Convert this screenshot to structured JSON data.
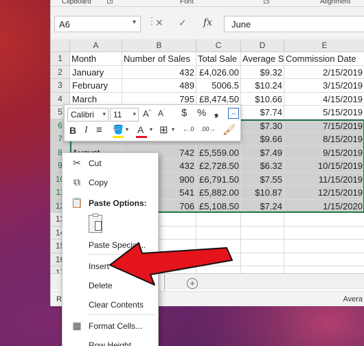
{
  "ribbon": {
    "clipboard_label": "Clipboard",
    "font_label": "Font",
    "alignment_label": "Alignment"
  },
  "formula_bar": {
    "name_box": "A6",
    "fx_symbol": "fx",
    "content": "June"
  },
  "columns": [
    "A",
    "B",
    "C",
    "D",
    "E"
  ],
  "rows": [
    {
      "num": "1",
      "a": "Month",
      "b": "Number of Sales",
      "c": "Total Sale",
      "d": "Average S",
      "e": "Commission Date"
    },
    {
      "num": "2",
      "a": "January",
      "b": "432",
      "c": "£4,026.00",
      "d": "$9.32",
      "e": "2/15/2019"
    },
    {
      "num": "3",
      "a": "February",
      "b": "489",
      "c": "5006.5",
      "d": "$10.24",
      "e": "3/15/2019"
    },
    {
      "num": "4",
      "a": "March",
      "b": "795",
      "c": "£8,474.50",
      "d": "$10.66",
      "e": "4/15/2019"
    },
    {
      "num": "5",
      "a": "",
      "b": "",
      "c": "",
      "d": "$7.74",
      "e": "5/15/2019"
    },
    {
      "num": "6",
      "a": "",
      "b": "",
      "c": "",
      "d": "$7.30",
      "e": "7/15/2019"
    },
    {
      "num": "7",
      "a": "",
      "b": "",
      "c": "",
      "d": "$9.66",
      "e": "8/15/2019"
    },
    {
      "num": "8",
      "a": "August",
      "b": "742",
      "c": "£5,559.00",
      "d": "$7.49",
      "e": "9/15/2019"
    },
    {
      "num": "9",
      "a": "",
      "b": "432",
      "c": "£2,728.50",
      "d": "$6.32",
      "e": "10/15/2019"
    },
    {
      "num": "10",
      "a": "",
      "b": "900",
      "c": "£6,791.50",
      "d": "$7.55",
      "e": "11/15/2019"
    },
    {
      "num": "11",
      "a": "",
      "b": "541",
      "c": "£5,882.00",
      "d": "$10.87",
      "e": "12/15/2019"
    },
    {
      "num": "12",
      "a": "",
      "b": "706",
      "c": "£5,108.50",
      "d": "$7.24",
      "e": "1/15/2020"
    },
    {
      "num": "13",
      "a": "",
      "b": "",
      "c": "",
      "d": "",
      "e": ""
    },
    {
      "num": "14",
      "a": "",
      "b": "",
      "c": "",
      "d": "",
      "e": ""
    },
    {
      "num": "15",
      "a": "",
      "b": "",
      "c": "",
      "d": "",
      "e": ""
    },
    {
      "num": "16",
      "a": "",
      "b": "",
      "c": "",
      "d": "",
      "e": ""
    },
    {
      "num": "17",
      "a": "",
      "b": "",
      "c": "",
      "d": "",
      "e": ""
    }
  ],
  "mini_toolbar": {
    "font_name": "Calibri",
    "font_size": "11",
    "bold": "B",
    "italic": "I",
    "currency": "$",
    "percent": "%",
    "comma": "ŉ"
  },
  "context_menu": {
    "cut": "Cut",
    "copy": "Copy",
    "paste_options": "Paste Options:",
    "paste_special": "Paste Special...",
    "insert": "Insert",
    "delete": "Delete",
    "clear_contents": "Clear Contents",
    "format_cells": "Format Cells...",
    "row_height": "Row Height..."
  },
  "status_bar": {
    "ready": "R",
    "average": "Avera"
  },
  "colors": {
    "arrow": "#e3141b",
    "selection_border": "#217346",
    "selected_fill": "#d0d0d0"
  }
}
